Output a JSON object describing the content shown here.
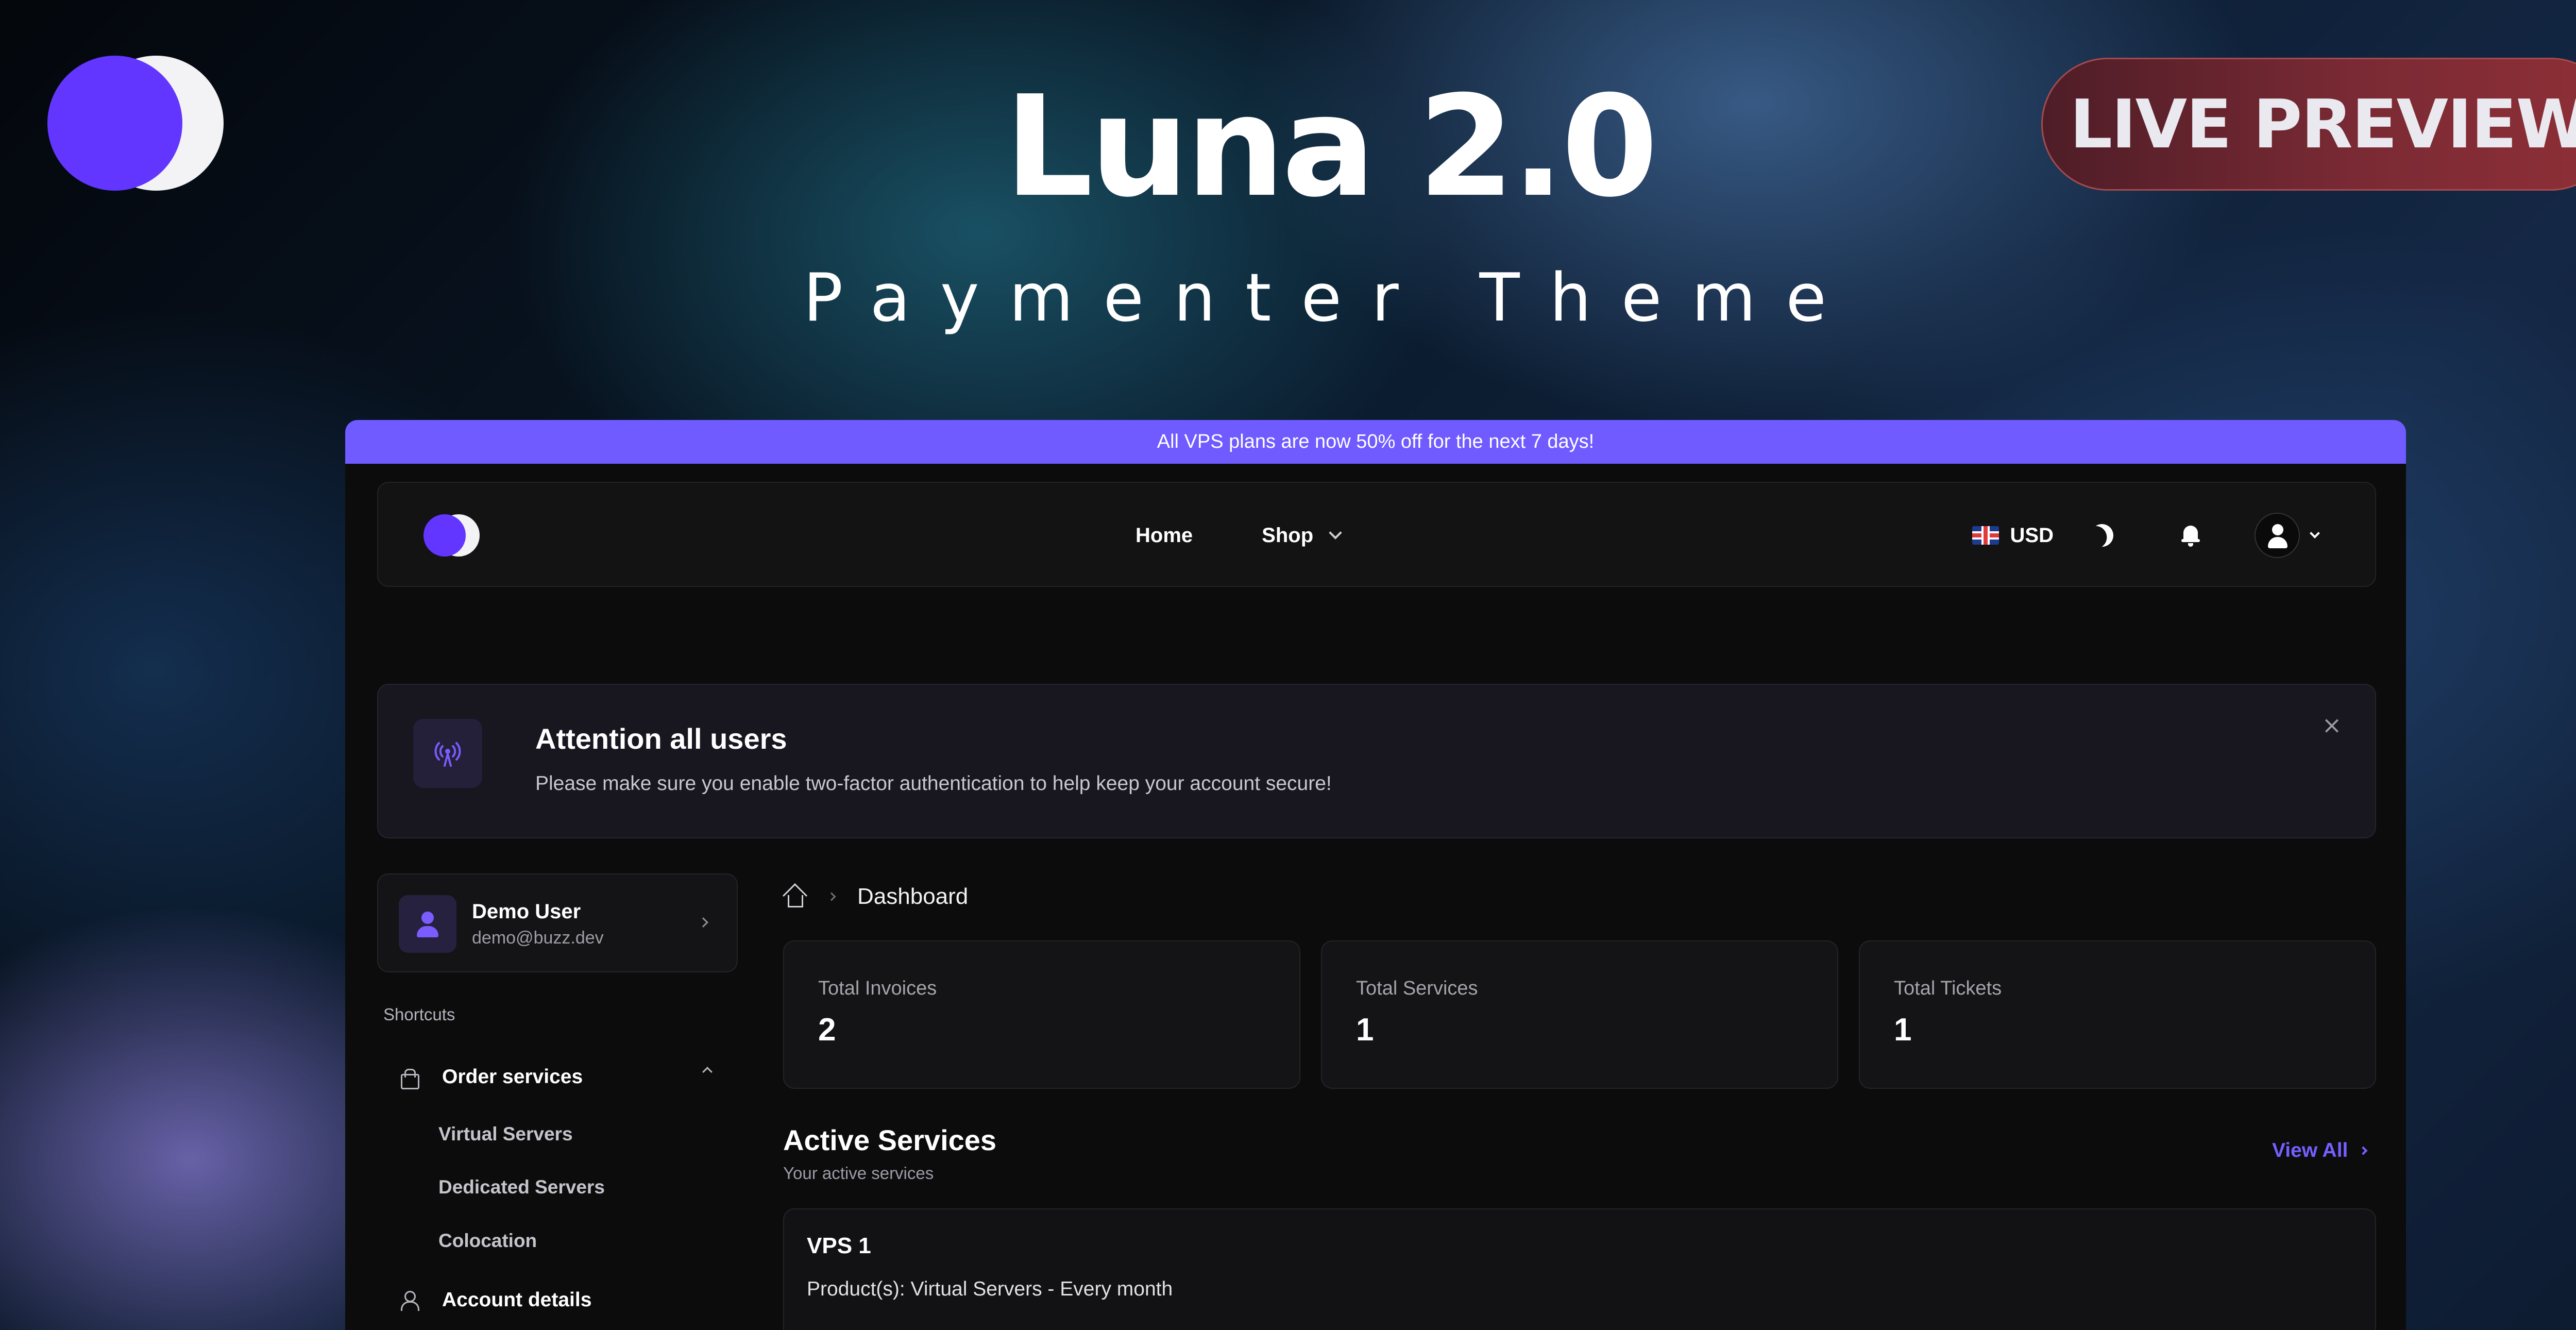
{
  "hero": {
    "title": "Luna 2.0",
    "subtitle": "Paymenter Theme",
    "live_preview_label": "LIVE PREVIEW"
  },
  "promo": {
    "text": "All VPS plans are now 50% off for the next 7 days!"
  },
  "navbar": {
    "links": [
      {
        "label": "Home"
      },
      {
        "label": "Shop",
        "has_dropdown": true
      }
    ],
    "currency": "USD",
    "flag_icon": "uk-flag-icon",
    "icons": [
      "moon-icon",
      "bell-icon",
      "user-icon"
    ]
  },
  "announcement": {
    "icon": "broadcast-icon",
    "title": "Attention all users",
    "text": "Please make sure you enable two-factor authentication to help keep your account secure!"
  },
  "sidebar": {
    "user": {
      "name": "Demo User",
      "email": "demo@buzz.dev"
    },
    "shortcuts_label": "Shortcuts",
    "items": [
      {
        "label": "Order services",
        "icon": "shopping-bag-icon",
        "expanded": true,
        "children": [
          {
            "label": "Virtual Servers"
          },
          {
            "label": "Dedicated Servers"
          },
          {
            "label": "Colocation"
          }
        ]
      },
      {
        "label": "Account details",
        "icon": "user-icon"
      }
    ]
  },
  "main": {
    "breadcrumb": "Dashboard",
    "stats": [
      {
        "label": "Total Invoices",
        "value": "2"
      },
      {
        "label": "Total Services",
        "value": "1"
      },
      {
        "label": "Total Tickets",
        "value": "1"
      }
    ],
    "active_services": {
      "title": "Active Services",
      "subtitle": "Your active services",
      "view_all": "View All",
      "services": [
        {
          "name": "VPS 1",
          "products": "Product(s): Virtual Servers - Every month"
        }
      ]
    }
  },
  "colors": {
    "accent": "#6236ff",
    "promo_bar": "#6f5bff",
    "live_preview": "#7a2a34",
    "app_bg": "#0c0c0d"
  }
}
